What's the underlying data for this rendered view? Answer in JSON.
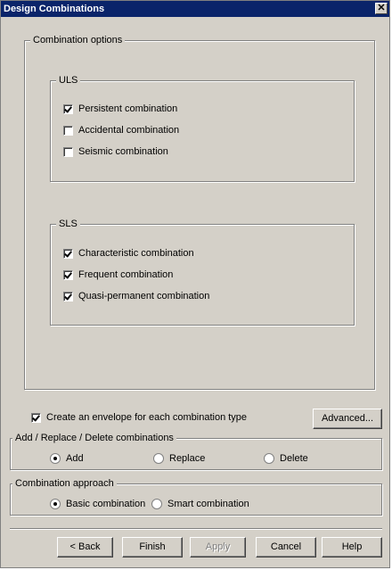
{
  "window": {
    "title": "Design Combinations",
    "close_glyph": "✕"
  },
  "combination_options": {
    "label": "Combination options",
    "uls": {
      "label": "ULS",
      "items": [
        {
          "label": "Persistent combination",
          "checked": true
        },
        {
          "label": "Accidental combination",
          "checked": false
        },
        {
          "label": "Seismic combination",
          "checked": false
        }
      ]
    },
    "sls": {
      "label": "SLS",
      "items": [
        {
          "label": "Characteristic combination",
          "checked": true
        },
        {
          "label": "Frequent combination",
          "checked": true
        },
        {
          "label": "Quasi-permanent combination",
          "checked": true
        }
      ]
    }
  },
  "envelope": {
    "label": "Create an envelope for each combination type",
    "checked": true
  },
  "advanced_button": "Advanced...",
  "add_replace_delete": {
    "label": "Add / Replace / Delete combinations",
    "options": [
      {
        "label": "Add",
        "selected": true
      },
      {
        "label": "Replace",
        "selected": false
      },
      {
        "label": "Delete",
        "selected": false
      }
    ]
  },
  "combination_approach": {
    "label": "Combination approach",
    "options": [
      {
        "label": "Basic combination",
        "selected": true
      },
      {
        "label": "Smart combination",
        "selected": false
      }
    ]
  },
  "buttons": {
    "back": "< Back",
    "finish": "Finish",
    "apply": "Apply",
    "cancel": "Cancel",
    "help": "Help"
  }
}
